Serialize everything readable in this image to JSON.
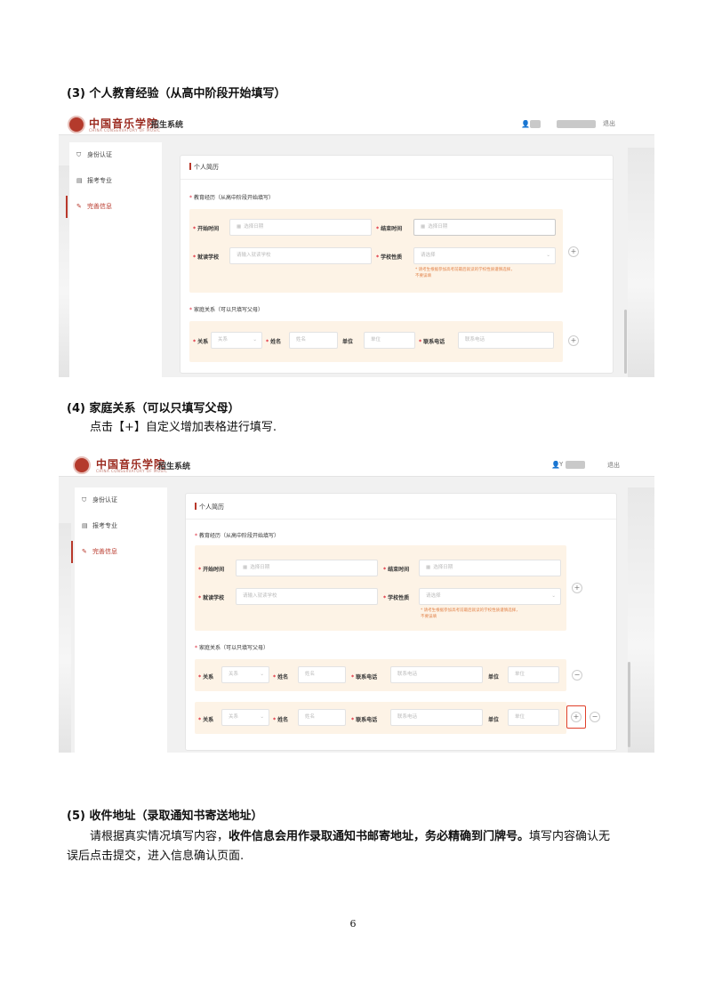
{
  "sections": {
    "s3_heading": "(3) 个人教育经验（从高中阶段开始填写）",
    "s4_heading": "(4) 家庭关系（可以只填写父母）",
    "s4_text": "点击【+】自定义增加表格进行填写.",
    "s5_heading": "(5) 收件地址（录取通知书寄送地址）",
    "s5_text_a": "请根据真实情况填写内容，",
    "s5_text_b": "收件信息会用作录取通知书邮寄地址，务必精确到门牌号。",
    "s5_text_c": "填写内容确认无",
    "s5_text_d": "误后点击提交，进入信息确认页面."
  },
  "page_number": "6",
  "app": {
    "brand": "中国音乐学院",
    "brand_sub": "CHINA CONSERVATORY OF MUSIC",
    "system_name": "招生系统",
    "user_prefix_1": "",
    "user_prefix_2": "Y",
    "logout": "退出",
    "sidebar": [
      "身份认证",
      "报考专业",
      "完善信息"
    ],
    "card_title": "个人简历",
    "edu_section": "教育经历（从高中阶段开始填写）",
    "family_section": "家庭关系（可以只填写父母）",
    "start_time_label": "开始时间",
    "end_time_label": "结束时间",
    "date_placeholder": "选择日期",
    "school_label": "就读学校",
    "school_placeholder": "请输入就读学校",
    "school_type_label": "学校性质",
    "select_placeholder": "请选择",
    "school_hint_1": "* 请考生根据参加高考前最后就读的学校性质谨慎选择，",
    "school_hint_2": "不要误填",
    "relation_label": "关系",
    "relation_placeholder": "关系",
    "name_label": "姓名",
    "name_placeholder": "姓名",
    "unit_label": "单位",
    "unit_placeholder": "单位",
    "phone_label": "联系电话",
    "phone_placeholder": "联系电话",
    "plus": "+",
    "minus": "−"
  }
}
